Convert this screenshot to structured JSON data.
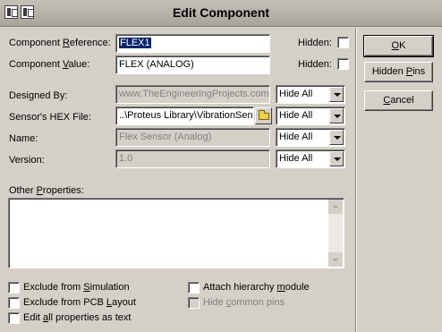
{
  "window": {
    "title": "Edit Component"
  },
  "fields": {
    "reference": {
      "label_pre": "Component ",
      "label_u": "R",
      "label_post": "eference:",
      "value": "FLEX1"
    },
    "value": {
      "label_pre": "Component ",
      "label_u": "V",
      "label_post": "alue:",
      "value": "FLEX (ANALOG)"
    },
    "hidden_label": "Hidden:"
  },
  "properties": [
    {
      "label": "Designed By:",
      "value": "www.TheEngineeringProjects.com",
      "visibility": "Hide All"
    },
    {
      "label": "Sensor's HEX File:",
      "value": "..\\Proteus Library\\VibrationSen",
      "visibility": "Hide All"
    },
    {
      "label": "Name:",
      "value": "Flex Sensor (Analog)",
      "visibility": "Hide All"
    },
    {
      "label": "Version:",
      "value": "1.0",
      "visibility": "Hide All"
    }
  ],
  "other_properties": {
    "label_pre": "Other ",
    "label_u": "P",
    "label_post": "roperties:",
    "value": ""
  },
  "options": {
    "exclude_sim": {
      "pre": "Exclude from ",
      "u": "S",
      "post": "imulation"
    },
    "exclude_pcb": {
      "pre": "Exclude from PCB ",
      "u": "L",
      "post": "ayout"
    },
    "edit_all": {
      "pre": "Edit ",
      "u": "a",
      "post": "ll properties as text"
    },
    "attach_hier": {
      "pre": "Attach hierarchy ",
      "u": "m",
      "post": "odule"
    },
    "hide_pins": {
      "pre": "Hide ",
      "u": "c",
      "post": "ommon pins"
    }
  },
  "buttons": {
    "ok": {
      "u": "O",
      "post": "K"
    },
    "hidden_pins": {
      "pre": "Hidden ",
      "u": "P",
      "post": "ins"
    },
    "cancel": {
      "u": "C",
      "post": "ancel"
    }
  }
}
